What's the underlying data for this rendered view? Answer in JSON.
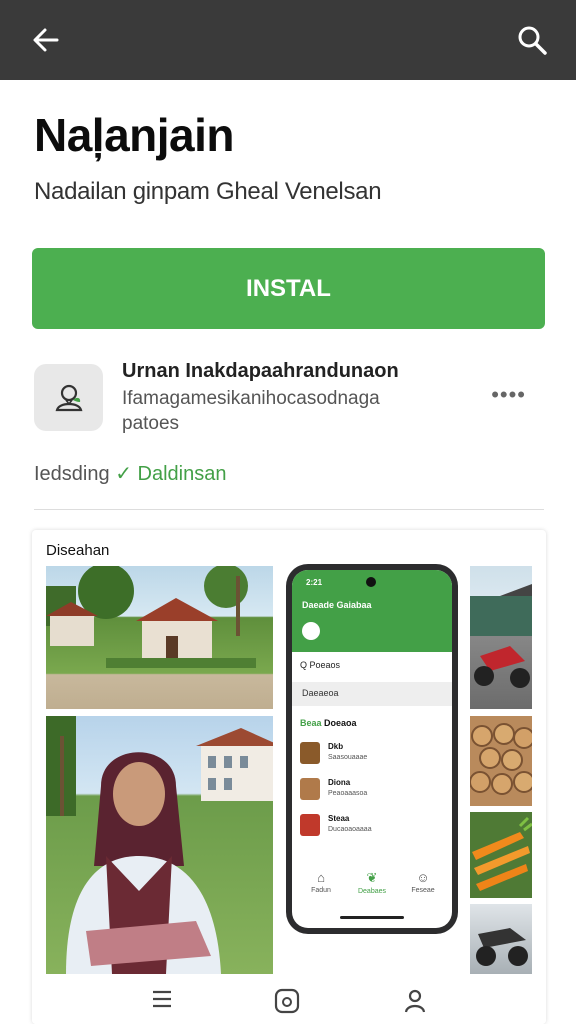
{
  "header": {
    "back_icon": "arrow-left-icon",
    "search_icon": "search-icon",
    "background": "#3a3a3a"
  },
  "app": {
    "title": "Naļanjain",
    "subtitle": "Nadailan ginpam Gheal Venelsan",
    "install_label": "INSTAL",
    "accent": "#4caf50"
  },
  "developer": {
    "name": "Urnan Inakdapaahrandunaon",
    "description": "Ifamagamesikanihocasodnaga patoes",
    "more_label": "••••"
  },
  "status": {
    "label": "Iedsding",
    "check": "✓",
    "value": "Daldinsan"
  },
  "gallery": {
    "label": "Diseahan",
    "phone": {
      "time": "2:21",
      "title": "Daeade Gaiabaa",
      "search": "Q  Poeaos",
      "tag": "Daeaeoa",
      "section_prefix": "Beaa",
      "section_rest": " Doeaoa",
      "items": [
        {
          "title": "Dkb",
          "sub": "Saasouaaae"
        },
        {
          "title": "Diona",
          "sub": "Peaoaaasoa"
        },
        {
          "title": "Steaa",
          "sub": "Ducaoaoaaaa"
        }
      ],
      "nav": [
        {
          "label": "Fadun"
        },
        {
          "label": "Deabaes"
        },
        {
          "label": "Feseae"
        }
      ]
    }
  }
}
